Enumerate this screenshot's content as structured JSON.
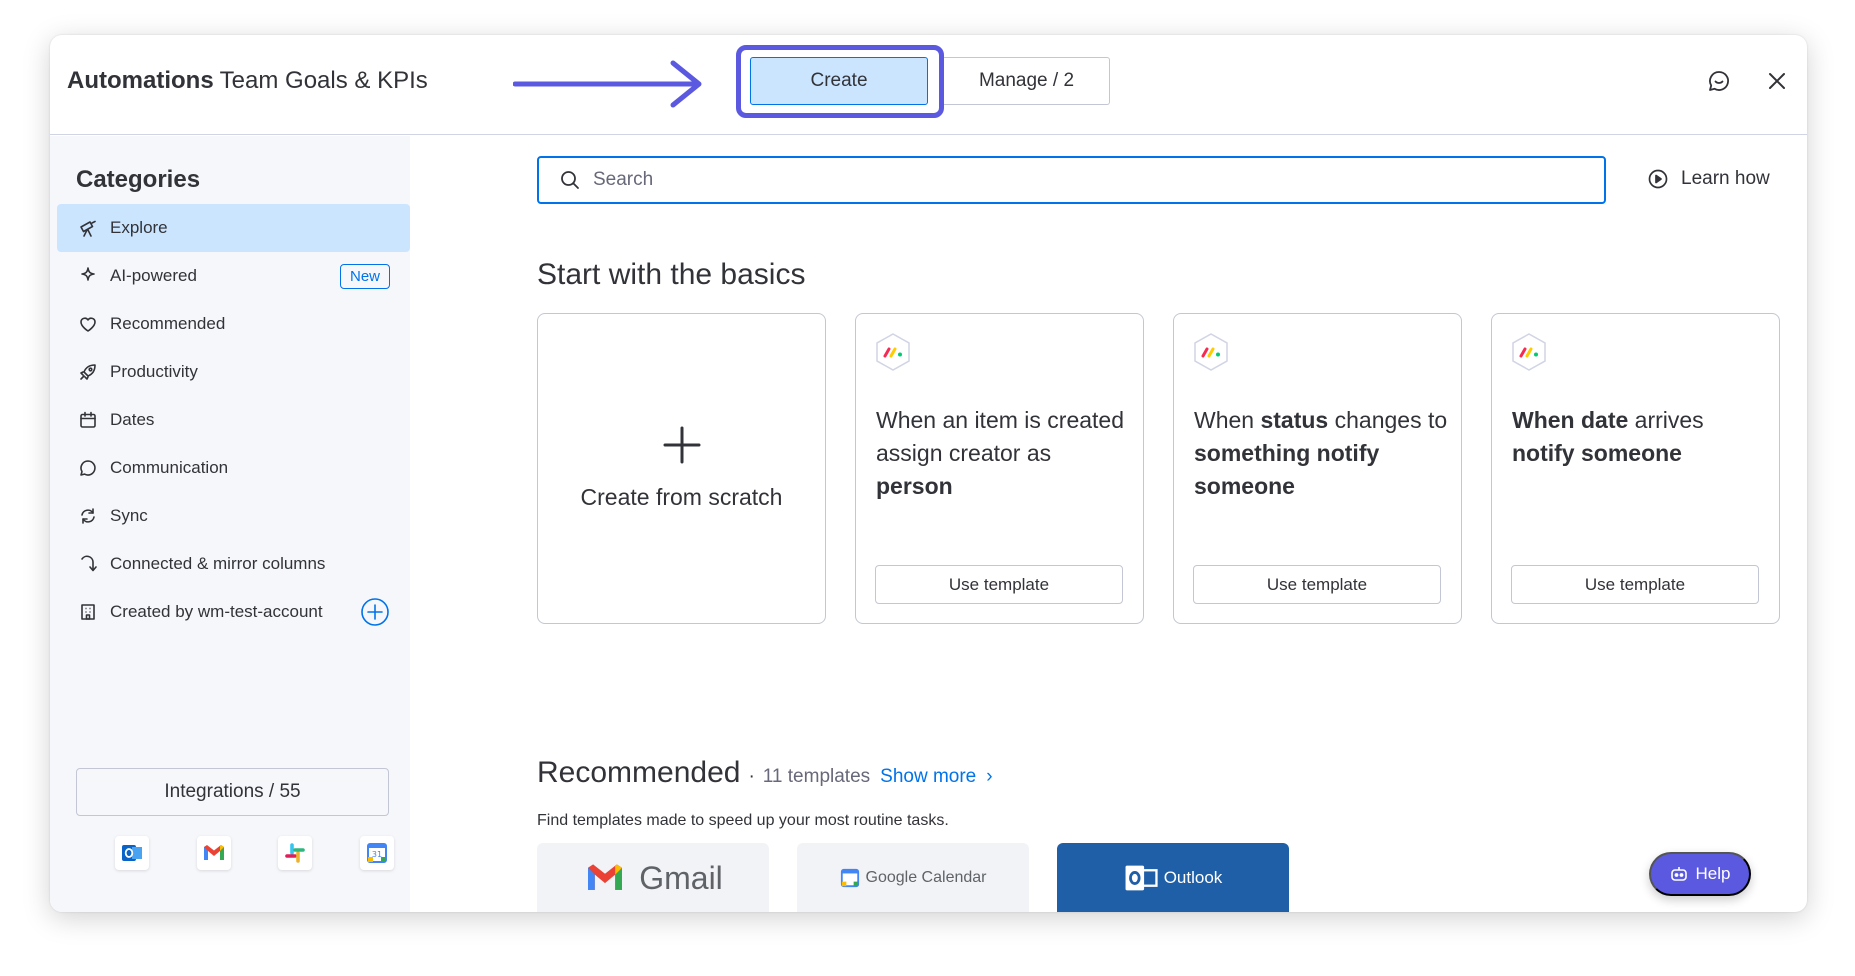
{
  "header": {
    "title_bold": "Automations",
    "title_rest": "Team Goals & KPIs",
    "create_label": "Create",
    "manage_label": "Manage / 2"
  },
  "sidebar": {
    "title": "Categories",
    "items": [
      {
        "label": "Explore",
        "icon": "telescope-icon",
        "active": true
      },
      {
        "label": "AI-powered",
        "icon": "sparkle-icon",
        "badge": "New"
      },
      {
        "label": "Recommended",
        "icon": "heart-icon"
      },
      {
        "label": "Productivity",
        "icon": "rocket-icon"
      },
      {
        "label": "Dates",
        "icon": "calendar-icon"
      },
      {
        "label": "Communication",
        "icon": "chat-bubble-icon"
      },
      {
        "label": "Sync",
        "icon": "sync-icon"
      },
      {
        "label": "Connected & mirror columns",
        "icon": "connect-arrow-icon"
      },
      {
        "label": "Created by wm-test-account",
        "icon": "building-icon"
      }
    ],
    "integrations_label": "Integrations / 55",
    "integration_icons": [
      "outlook-icon",
      "gmail-icon",
      "slack-icon",
      "google-calendar-icon"
    ]
  },
  "main": {
    "search_placeholder": "Search",
    "learn_how": "Learn how",
    "basics_title": "Start with the basics",
    "scratch_label": "Create from scratch",
    "use_template_label": "Use template",
    "recommended_title": "Recommended",
    "recommended_dot": "·",
    "recommended_count": "11 templates",
    "show_more": "Show more",
    "recommended_sub": "Find templates made to speed up your most routine tasks.",
    "tpl_gmail": "Gmail",
    "tpl_gcal": "Google Calendar",
    "tpl_outlook": "Outlook",
    "help_label": "Help"
  },
  "cards": [
    {
      "p1": "When an item is created assign creator as ",
      "b1": "person"
    },
    {
      "p1": "When ",
      "b1": "status",
      "p2": " changes to ",
      "b2": "something notify someone"
    },
    {
      "b1": "When date",
      "p2": " arrives ",
      "b2": "notify someone"
    }
  ],
  "colors": {
    "primary": "#0073ea",
    "selected_bg": "#cce5ff",
    "highlight_outline": "#5b59e0",
    "sidebar_bg": "#f6f7fb",
    "outlook_blue": "#1f5fa7"
  }
}
